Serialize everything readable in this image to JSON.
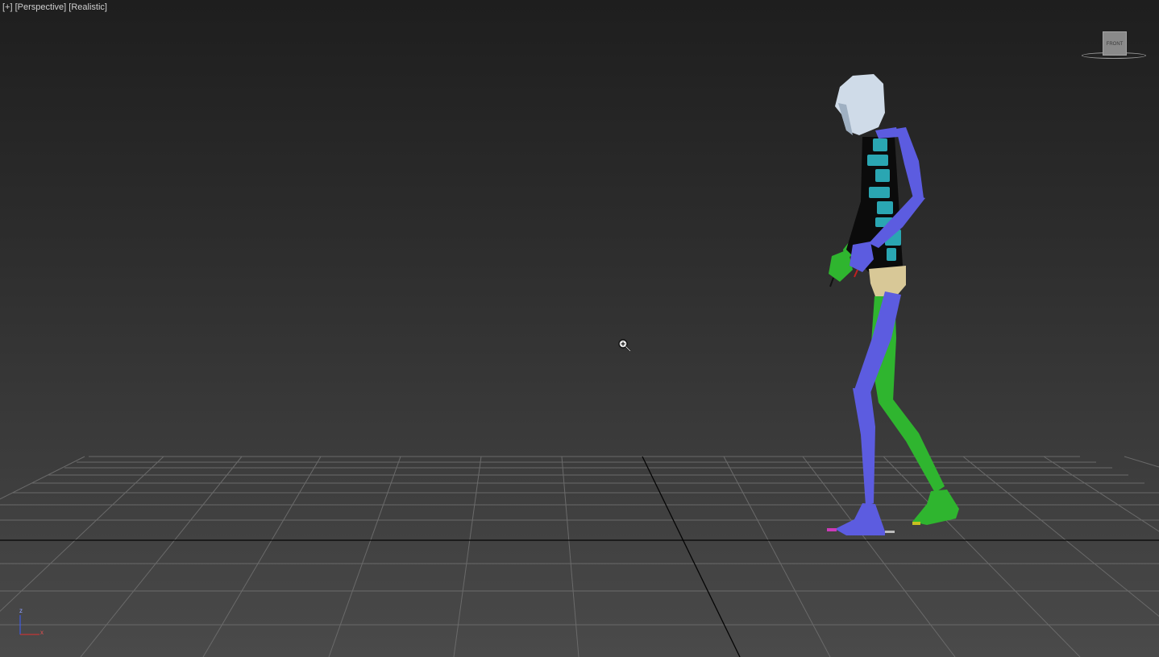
{
  "viewport": {
    "label_parts": [
      "[+]",
      "[Perspective]",
      "[Realistic]"
    ]
  },
  "viewcube": {
    "face_label": "FRONT"
  },
  "axis_tripod": {
    "z_label": "z",
    "x_label": "x",
    "colors": {
      "z": "#3a5cff",
      "x": "#e03030"
    }
  },
  "scene": {
    "object": "biped skeleton",
    "colors": {
      "head": "#cfdbe8",
      "spine": "#2aa6b2",
      "left_limbs": "#2fb52f",
      "right_limbs": "#5c5ce0",
      "pelvis": "#d8c897",
      "grid_lines": "#6e6e6e",
      "home_grid_axes": "#050505"
    }
  },
  "cursor": {
    "icon": "zoom-cursor-icon"
  }
}
